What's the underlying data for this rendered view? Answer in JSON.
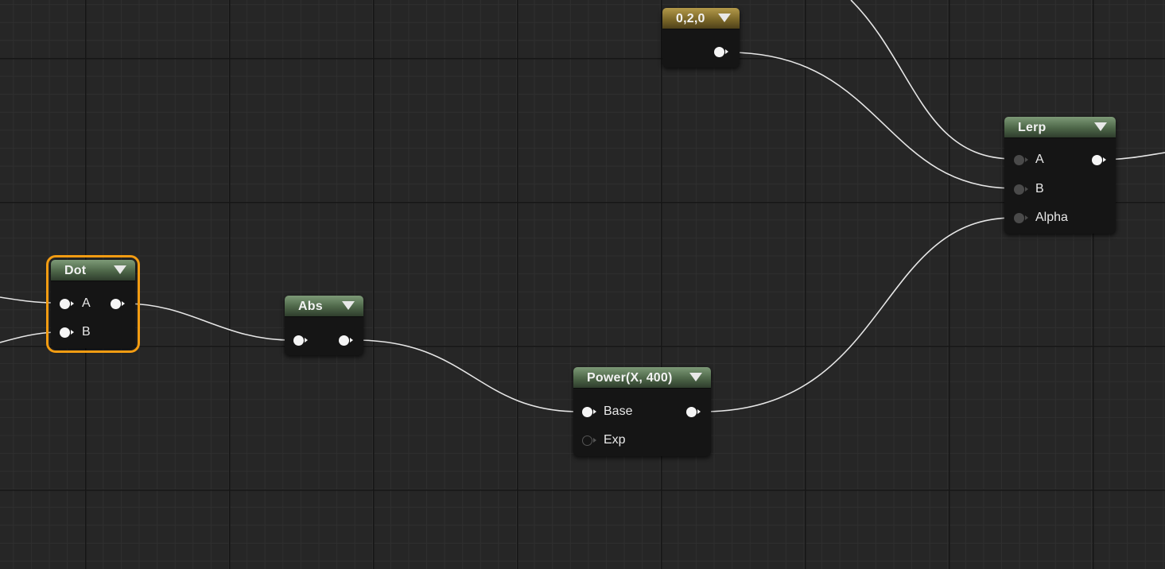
{
  "graph": {
    "nodes": {
      "constant": {
        "title": "0,2,0"
      },
      "lerp": {
        "title": "Lerp",
        "inputs": [
          "A",
          "B",
          "Alpha"
        ]
      },
      "dot": {
        "title": "Dot",
        "inputs": [
          "A",
          "B"
        ],
        "selected": true
      },
      "abs": {
        "title": "Abs"
      },
      "power": {
        "title": "Power(X, 400)",
        "inputs": [
          "Base",
          "Exp"
        ]
      }
    }
  },
  "colors": {
    "background": "#262626",
    "node_body": "#151515",
    "material_header": "#4d6648",
    "constant_header": "#7c6829",
    "selection_outline": "#f39c12",
    "wire": "#e6e6e6"
  },
  "icons": {
    "collapse": "triangle-down-icon",
    "pin": "circle-pin-icon"
  }
}
